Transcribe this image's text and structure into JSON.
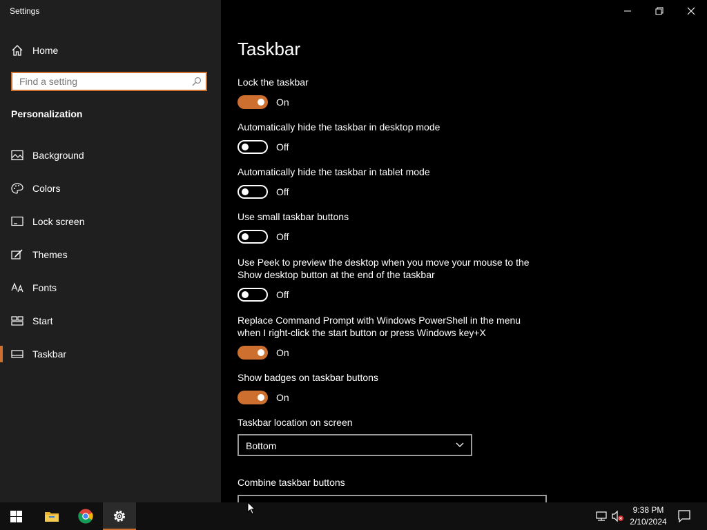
{
  "window": {
    "title": "Settings",
    "minimize_icon": "minimize-icon",
    "restore_icon": "restore-icon",
    "close_icon": "close-icon"
  },
  "sidebar": {
    "home_label": "Home",
    "search_placeholder": "Find a setting",
    "section_title": "Personalization",
    "items": [
      {
        "label": "Background",
        "icon": "picture-icon",
        "active": false
      },
      {
        "label": "Colors",
        "icon": "palette-icon",
        "active": false
      },
      {
        "label": "Lock screen",
        "icon": "lock-screen-icon",
        "active": false
      },
      {
        "label": "Themes",
        "icon": "brush-icon",
        "active": false
      },
      {
        "label": "Fonts",
        "icon": "fonts-icon",
        "active": false
      },
      {
        "label": "Start",
        "icon": "start-icon",
        "active": false
      },
      {
        "label": "Taskbar",
        "icon": "taskbar-icon",
        "active": true
      }
    ]
  },
  "main": {
    "title": "Taskbar",
    "settings": [
      {
        "label": "Lock the taskbar",
        "on": true,
        "state": "On"
      },
      {
        "label": "Automatically hide the taskbar in desktop mode",
        "on": false,
        "state": "Off"
      },
      {
        "label": "Automatically hide the taskbar in tablet mode",
        "on": false,
        "state": "Off"
      },
      {
        "label": "Use small taskbar buttons",
        "on": false,
        "state": "Off"
      },
      {
        "label": "Use Peek to preview the desktop when you move your mouse to the Show desktop button at the end of the taskbar",
        "on": false,
        "state": "Off"
      },
      {
        "label": "Replace Command Prompt with Windows PowerShell in the menu when I right-click the start button or press Windows key+X",
        "on": true,
        "state": "On"
      },
      {
        "label": "Show badges on taskbar buttons",
        "on": true,
        "state": "On"
      }
    ],
    "location_label": "Taskbar location on screen",
    "location_value": "Bottom",
    "combine_label": "Combine taskbar buttons"
  },
  "taskbar": {
    "apps": [
      "windows-start-icon",
      "file-explorer-icon",
      "chrome-icon",
      "settings-gear-icon"
    ],
    "time": "9:38 PM",
    "date": "2/10/2024"
  },
  "colors": {
    "accent": "#cc6f2f",
    "sidebar_bg": "#1f1f1f",
    "main_bg": "#000000",
    "taskbar_bg": "#101010"
  }
}
